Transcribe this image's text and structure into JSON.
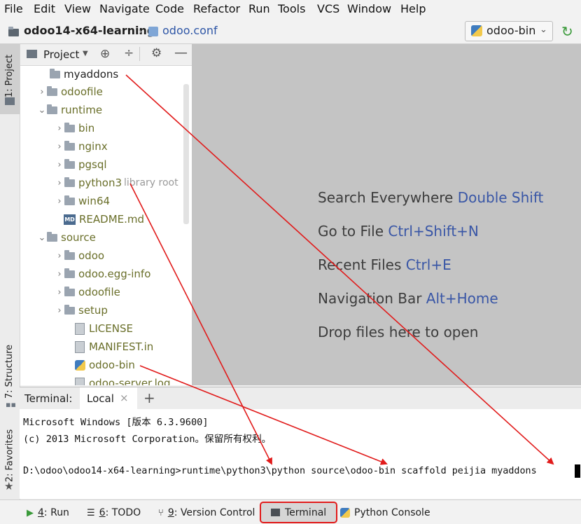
{
  "menu": [
    "File",
    "Edit",
    "View",
    "Navigate",
    "Code",
    "Refactor",
    "Run",
    "Tools",
    "VCS",
    "Window",
    "Help"
  ],
  "breadcrumb": {
    "project": "odoo14-x64-learning",
    "file": "odoo.conf"
  },
  "run_config": "odoo-bin",
  "left_tabs": {
    "project": "1: Project",
    "structure": "7: Structure",
    "favorites": "2: Favorites"
  },
  "project_panel": {
    "title": "Project"
  },
  "tree": [
    {
      "label": "myaddons",
      "style": "normal",
      "expand": ""
    },
    {
      "label": "odoofile",
      "style": "olive",
      "expand": "›"
    },
    {
      "label": "runtime",
      "style": "olive",
      "expand": "⌄"
    },
    {
      "label": "bin",
      "style": "olive",
      "expand": "›"
    },
    {
      "label": "nginx",
      "style": "olive",
      "expand": "›"
    },
    {
      "label": "pgsql",
      "style": "olive",
      "expand": "›"
    },
    {
      "label": "python3",
      "style": "olive",
      "expand": "›",
      "suffix": "library root"
    },
    {
      "label": "win64",
      "style": "olive",
      "expand": "›"
    },
    {
      "label": "README.md",
      "style": "olive",
      "expand": ""
    },
    {
      "label": "source",
      "style": "olive",
      "expand": "⌄"
    },
    {
      "label": "odoo",
      "style": "olive",
      "expand": "›"
    },
    {
      "label": "odoo.egg-info",
      "style": "olive",
      "expand": "›"
    },
    {
      "label": "odoofile",
      "style": "olive",
      "expand": "›"
    },
    {
      "label": "setup",
      "style": "olive",
      "expand": "›"
    },
    {
      "label": "LICENSE",
      "style": "olive",
      "expand": ""
    },
    {
      "label": "MANIFEST.in",
      "style": "olive",
      "expand": ""
    },
    {
      "label": "odoo-bin",
      "style": "olive",
      "expand": ""
    },
    {
      "label": "odoo-server.log",
      "style": "olive",
      "expand": ""
    }
  ],
  "editor_hints": [
    {
      "text": "Search Everywhere",
      "key": "Double Shift"
    },
    {
      "text": "Go to File",
      "key": "Ctrl+Shift+N"
    },
    {
      "text": "Recent Files",
      "key": "Ctrl+E"
    },
    {
      "text": "Navigation Bar",
      "key": "Alt+Home"
    },
    {
      "text": "Drop files here to open",
      "key": ""
    }
  ],
  "terminal": {
    "label": "Terminal:",
    "tab": "Local",
    "close": "×",
    "add": "+",
    "lines": [
      "Microsoft Windows [版本 6.3.9600]",
      "(c) 2013 Microsoft Corporation。保留所有权利。",
      "",
      "D:\\odoo\\odoo14-x64-learning>runtime\\python3\\python source\\odoo-bin scaffold peijia myaddons"
    ]
  },
  "bottom_tabs": {
    "run": {
      "num": "4",
      "text": ": Run"
    },
    "todo": {
      "num": "6",
      "text": ": TODO"
    },
    "vcs": {
      "num": "9",
      "text": ": Version Control"
    },
    "terminal": "Terminal",
    "console": "Python Console"
  },
  "colors": {
    "annotation": "#e11b1b",
    "hint_key": "#3956a6",
    "olive_text": "#6a6f2a"
  }
}
